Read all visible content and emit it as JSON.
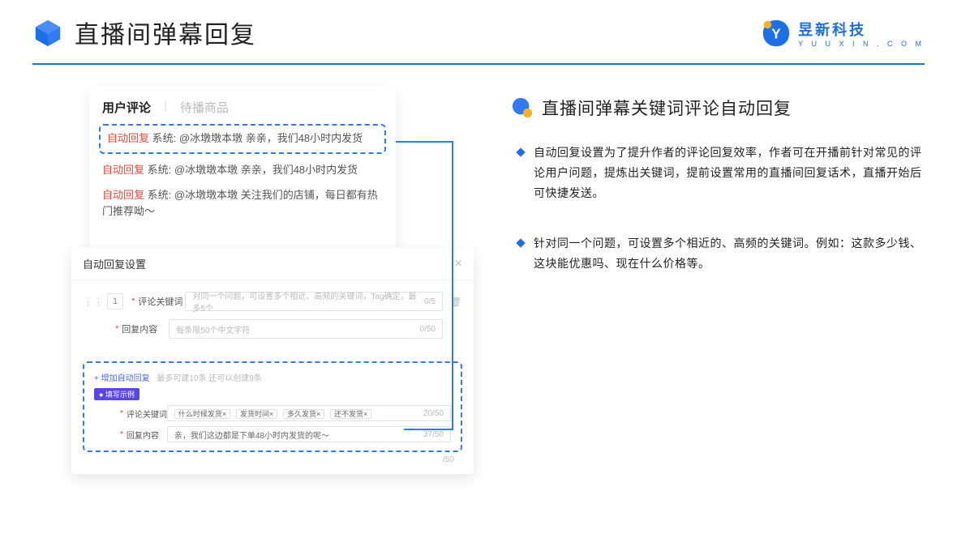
{
  "header": {
    "title": "直播间弹幕回复",
    "brand_cn": "昱新科技",
    "brand_en": "Y U U X I N . C O M"
  },
  "comment_panel": {
    "tabs": {
      "active": "用户评论",
      "inactive": "待播商品"
    },
    "items": [
      {
        "label": "自动回复",
        "sys": "系统:",
        "text": "@冰墩墩本墩 亲亲，我们48小时内发货",
        "highlighted": true
      },
      {
        "label": "自动回复",
        "sys": "系统:",
        "text": "@冰墩墩本墩 亲亲，我们48小时内发货"
      },
      {
        "label": "自动回复",
        "sys": "系统:",
        "text": "@冰墩墩本墩 关注我们的店铺，每日都有热门推荐呦～"
      }
    ]
  },
  "settings": {
    "title": "自动回复设置",
    "num": "1",
    "kw_label": "评论关键词",
    "kw_placeholder": "对同一个问题，可设置多个相近、高频的关键词，Tag确定，最多5个",
    "kw_count": "0/5",
    "content_label": "回复内容",
    "content_placeholder": "每条限50个中文字符",
    "content_count": "0/50",
    "add_link": "+ 增加自动回复",
    "add_hint": "最多可建10条 还可以创建9条",
    "example_badge": "● 填写示例",
    "ex_kw_label": "评论关键词",
    "ex_tags": [
      "什么时候发货×",
      "发货时间×",
      "多久发货×",
      "还不发货×"
    ],
    "ex_kw_count": "20/50",
    "ex_content_label": "回复内容",
    "ex_content_text": "亲，我们这边都是下单48小时内发货的呢～",
    "ex_content_count": "37/50",
    "bottom_count": "/50"
  },
  "right": {
    "section_title": "直播间弹幕关键词评论自动回复",
    "bullets": [
      "自动回复设置为了提升作者的评论回复效率，作者可在开播前针对常见的评论用户问题，提炼出关键词，提前设置常用的直播间回复话术，直播开始后可快捷发送。",
      "针对同一个问题，可设置多个相近的、高频的关键词。例如：这款多少钱、这块能优惠吗、现在什么价格等。"
    ]
  }
}
